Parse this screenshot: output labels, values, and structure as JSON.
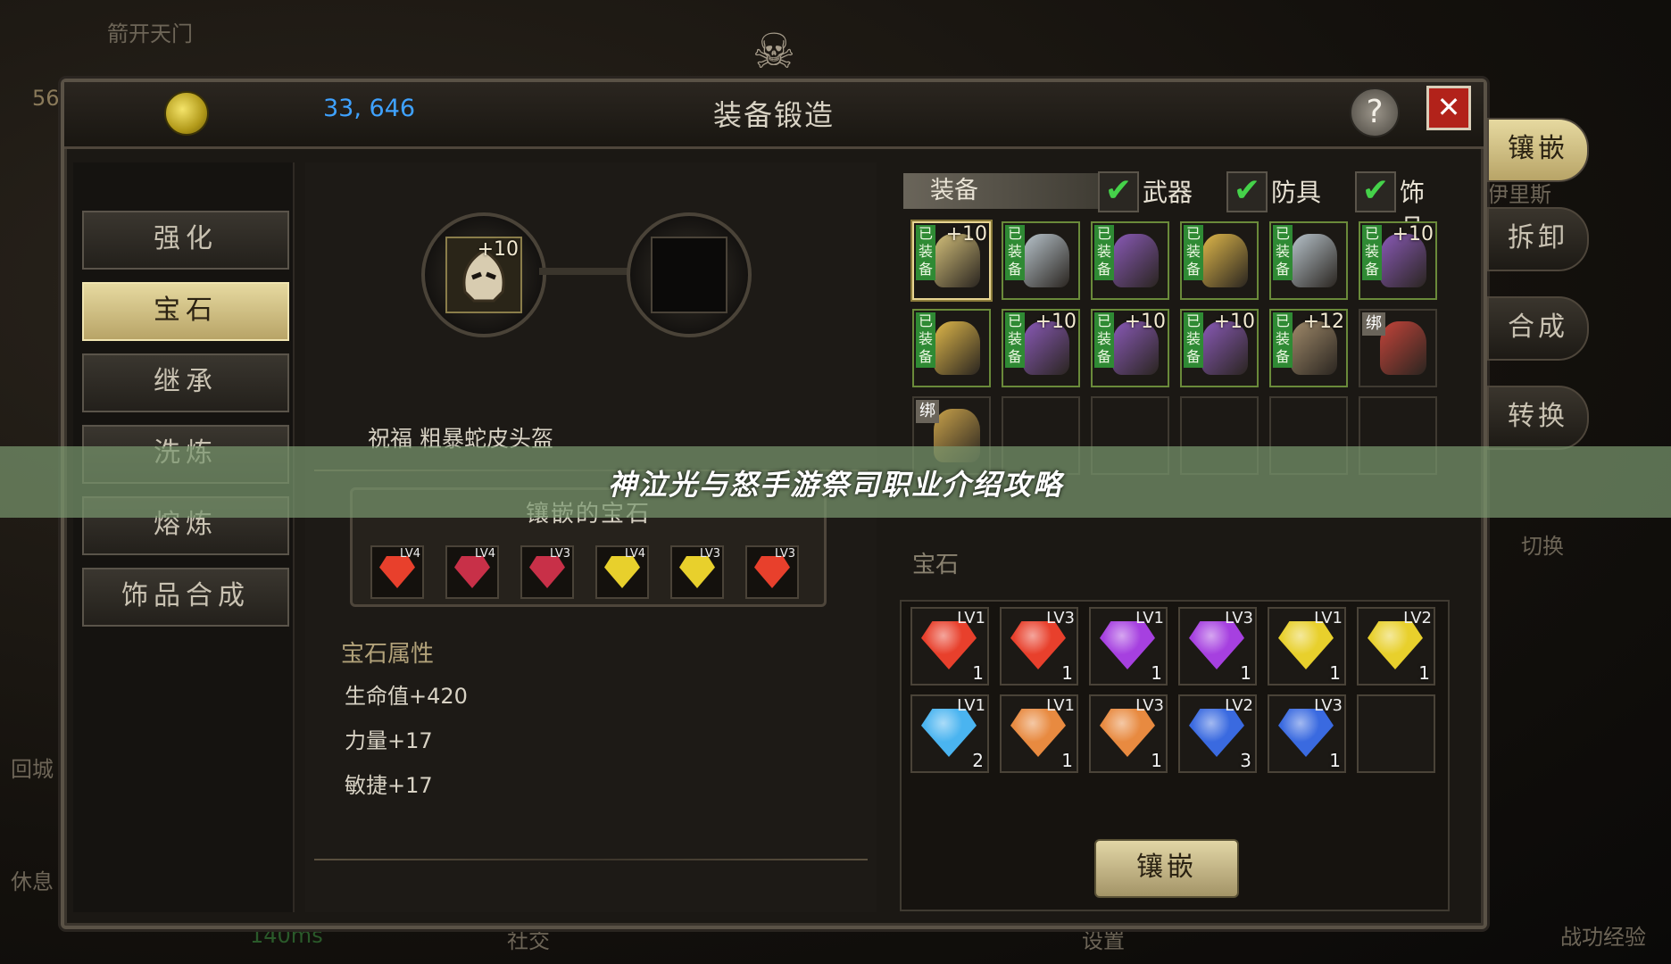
{
  "window": {
    "title": "装备锻造",
    "coins": "33, 646",
    "help": "?",
    "close": "✕"
  },
  "hud": {
    "top_left": "箭开天门",
    "level": "56",
    "home": "回城",
    "rest": "休息",
    "social": "社交",
    "settings": "设置",
    "battle": "战功经验",
    "ping": "140ms",
    "switch": "切换",
    "name": "伊里斯"
  },
  "nav": {
    "items": [
      "强化",
      "宝石",
      "继承",
      "洗炼",
      "熔炼",
      "饰品合成"
    ],
    "active_index": 1
  },
  "center": {
    "target_plus": "+10",
    "item_name": "祝福 粗暴蛇皮头盔",
    "inlaid_title": "镶嵌的宝石",
    "inlaid_gems": [
      {
        "lv": "LV4",
        "color": "#e8402c"
      },
      {
        "lv": "LV4",
        "color": "#c83048"
      },
      {
        "lv": "LV3",
        "color": "#c83048"
      },
      {
        "lv": "LV4",
        "color": "#e8d02c"
      },
      {
        "lv": "LV3",
        "color": "#e8d02c"
      },
      {
        "lv": "LV3",
        "color": "#e8402c"
      }
    ],
    "attr_title": "宝石属性",
    "attrs": [
      "生命值+420",
      "力量+17",
      "敏捷+17"
    ]
  },
  "filters": {
    "equip_label": "装备",
    "options": [
      "武器",
      "防具",
      "饰品"
    ],
    "check": "✔"
  },
  "equip_grid": [
    {
      "tag": "已装备",
      "plus": "+10",
      "color": "#d4c07a",
      "selected": true
    },
    {
      "tag": "已装备",
      "plus": "",
      "color": "#b8c4cc"
    },
    {
      "tag": "已装备",
      "plus": "",
      "color": "#8a5ab8"
    },
    {
      "tag": "已装备",
      "plus": "",
      "color": "#e0b84a"
    },
    {
      "tag": "已装备",
      "plus": "",
      "color": "#b8c4cc"
    },
    {
      "tag": "已装备",
      "plus": "+10",
      "color": "#8a5ab8"
    },
    {
      "tag": "已装备",
      "plus": "",
      "color": "#e0b84a"
    },
    {
      "tag": "已装备",
      "plus": "+10",
      "color": "#8a5ab8"
    },
    {
      "tag": "已装备",
      "plus": "+10",
      "color": "#8a5ab8"
    },
    {
      "tag": "已装备",
      "plus": "+10",
      "color": "#8a5ab8"
    },
    {
      "tag": "已装备",
      "plus": "+12",
      "color": "#a08a6a"
    },
    {
      "tag": "绑",
      "plus": "",
      "color": "#c4443a"
    },
    {
      "tag": "绑",
      "plus": "",
      "color": "#c9a24a"
    },
    {
      "tag": "",
      "plus": ""
    },
    {
      "tag": "",
      "plus": ""
    },
    {
      "tag": "",
      "plus": ""
    },
    {
      "tag": "",
      "plus": ""
    },
    {
      "tag": "",
      "plus": ""
    }
  ],
  "gem_label": "宝石",
  "gem_grid": [
    {
      "lv": "LV1",
      "count": "1",
      "color": "#e8402c"
    },
    {
      "lv": "LV3",
      "count": "1",
      "color": "#e8402c"
    },
    {
      "lv": "LV1",
      "count": "1",
      "color": "#a640e0"
    },
    {
      "lv": "LV3",
      "count": "1",
      "color": "#a640e0"
    },
    {
      "lv": "LV1",
      "count": "1",
      "color": "#e8d02c"
    },
    {
      "lv": "LV2",
      "count": "1",
      "color": "#e8d02c"
    },
    {
      "lv": "LV1",
      "count": "2",
      "color": "#4ab4f0"
    },
    {
      "lv": "LV1",
      "count": "1",
      "color": "#e88a40"
    },
    {
      "lv": "LV3",
      "count": "1",
      "color": "#e88a40"
    },
    {
      "lv": "LV2",
      "count": "3",
      "color": "#3a6ae0"
    },
    {
      "lv": "LV3",
      "count": "1",
      "color": "#3a6ae0"
    },
    {
      "lv": "",
      "count": ""
    }
  ],
  "inlay_button": "镶嵌",
  "side_tabs": [
    "镶嵌",
    "拆卸",
    "合成",
    "转换"
  ],
  "banner": "神泣光与怒手游祭司职业介绍攻略"
}
